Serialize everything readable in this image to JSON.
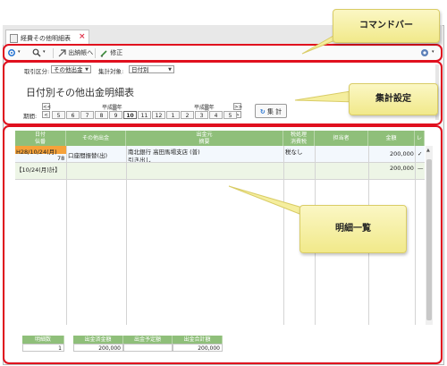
{
  "tab": {
    "label": "経費その他明細表"
  },
  "toolbar": {
    "journal_label": "出納帳へ",
    "edit_label": "修正"
  },
  "callouts": {
    "command_bar": "コマンドバー",
    "aggregate_settings": "集計設定",
    "detail_list": "明細一覧"
  },
  "settings": {
    "kind_label": "取引区分:",
    "kind_value": "その他出金",
    "target_label": "集計対象:",
    "target_value": "日付別",
    "title": "日付別その他出金明細表",
    "period_label": "期間:",
    "era_left": "平成▒年",
    "era_right": "平成▒年",
    "months": [
      "5",
      "6",
      "7",
      "8",
      "9",
      "10",
      "11",
      "12",
      "1",
      "2",
      "3",
      "4",
      "5"
    ],
    "active_month": "10",
    "nav_first": "<<",
    "nav_prev": "<",
    "nav_next": ">",
    "nav_last": ">>",
    "aggregate_button": "集 計"
  },
  "grid": {
    "headers_top": [
      "日付",
      "その他出金",
      "出金元",
      "税処理",
      "担当者",
      "金額",
      "レ"
    ],
    "headers_bottom": [
      "伝番",
      "摘要",
      "消費税"
    ],
    "rows": [
      {
        "date": "H28/10/24(月)",
        "voucher": "78",
        "category": "口座間振替(出)",
        "source": "南北銀行 高田馬場支店 (普)",
        "memo": "引き出し",
        "tax": "税なし",
        "staff": "",
        "amount": "200,000",
        "check": "✓"
      },
      {
        "date": "【10/24(月)計】",
        "amount": "200,000",
        "check": "—"
      }
    ]
  },
  "footer": {
    "count_label": "明細数",
    "count_value": "1",
    "total_out_label": "出金済金額",
    "total_out_value": "200,000",
    "planned_label": "出金予定額",
    "planned_value": "",
    "sum_label": "出金合計額",
    "sum_value": "200,000"
  }
}
